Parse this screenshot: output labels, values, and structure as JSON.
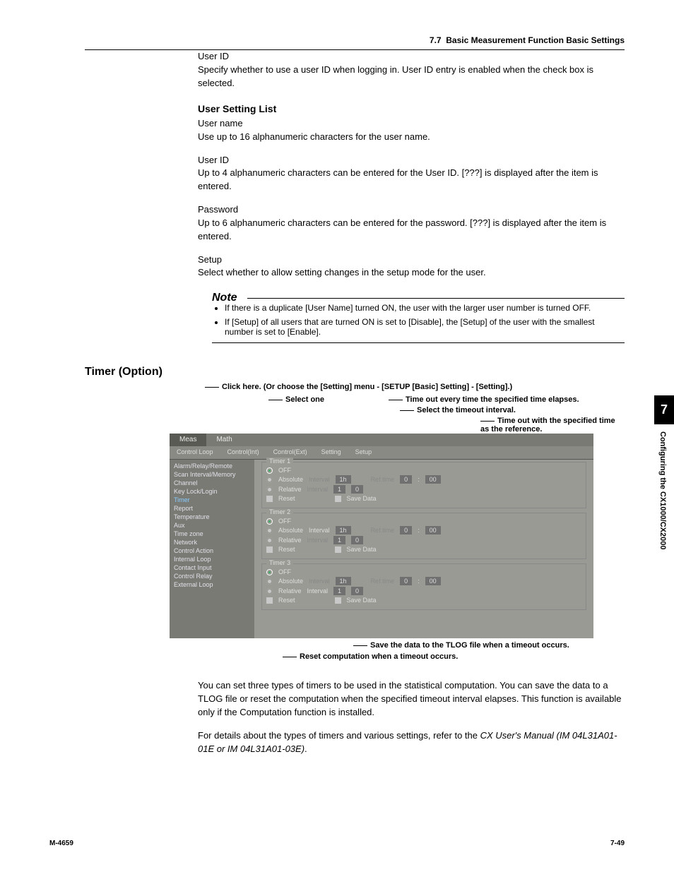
{
  "header": {
    "section_number": "7.7",
    "section_title": "Basic Measurement Function Basic Settings"
  },
  "userid_block": {
    "label": "User ID",
    "text": "Specify whether to use a user ID when logging in. User ID entry is enabled when the check box is selected."
  },
  "user_setting_list": {
    "heading": "User Setting List",
    "username": {
      "label": "User name",
      "text": "Use up to 16 alphanumeric characters for the user name."
    },
    "userid": {
      "label": "User ID",
      "text": "Up to 4 alphanumeric characters can be entered for the User ID.  [???] is displayed after the item is entered."
    },
    "password": {
      "label": "Password",
      "text": "Up to 6 alphanumeric characters can be entered for the password.  [???] is displayed after the item is entered."
    },
    "setup": {
      "label": "Setup",
      "text": "Select whether to allow setting changes in the setup mode for the user."
    }
  },
  "note": {
    "title": "Note",
    "items": [
      "If there is a duplicate [User Name] turned ON, the user with the larger user number is turned OFF.",
      "If [Setup] of all users that are turned ON is set to [Disable], the [Setup] of the user with the smallest number is set to [Enable]."
    ]
  },
  "timer_section_heading": "Timer (Option)",
  "callouts_top": {
    "click": "Click here. (Or choose the [Setting] menu - [SETUP [Basic] Setting] - [Setting].)",
    "select_one": "Select one",
    "timeout_every": "Time out every time the specified time elapses.",
    "timeout_interval": "Select the timeout interval.",
    "timeout_ref": "Time out with the specified time as the reference."
  },
  "screenshot": {
    "top_tabs": [
      "Meas",
      "Math"
    ],
    "sub_tabs": [
      "Control Loop",
      "Control(Int)",
      "Control(Ext)",
      "Setting",
      "Setup"
    ],
    "sidebar": [
      "Alarm/Relay/Remote",
      "Scan Interval/Memory",
      "Channel",
      "Key Lock/Login",
      "Timer",
      "Report",
      "Temperature",
      "Aux",
      "Time zone",
      "Network",
      "Control Action",
      "Internal Loop",
      "Contact Input",
      "Control Relay",
      "External Loop"
    ],
    "sidebar_active": "Timer",
    "groups": [
      {
        "label": "Timer 1",
        "off": "OFF",
        "absolute": "Absolute",
        "abs_int_lbl": "Interval",
        "abs_int_val": "1h",
        "ref_lbl": "Ref.time",
        "ref_h": "0",
        "ref_m": "00",
        "relative": "Relative",
        "rel_int_lbl": "Interval",
        "rel_h": "1",
        "rel_m": "0",
        "reset": "Reset",
        "save": "Save Data"
      },
      {
        "label": "Timer 2",
        "off": "OFF",
        "absolute": "Absolute",
        "abs_int_lbl": "Interval",
        "abs_int_val": "1h",
        "ref_lbl": "Ref.time",
        "ref_h": "0",
        "ref_m": "00",
        "relative": "Relative",
        "rel_int_lbl": "Interval",
        "rel_h": "1",
        "rel_m": "0",
        "reset": "Reset",
        "save": "Save Data"
      },
      {
        "label": "Timer 3",
        "off": "OFF",
        "absolute": "Absolute",
        "abs_int_lbl": "Interval",
        "abs_int_val": "1h",
        "ref_lbl": "Ref.time",
        "ref_h": "0",
        "ref_m": "00",
        "relative": "Relative",
        "rel_int_lbl": "Interval",
        "rel_h": "1",
        "rel_m": "0",
        "reset": "Reset",
        "save": "Save Data"
      }
    ]
  },
  "callouts_bottom": {
    "save": "Save the data to the TLOG file when a timeout occurs.",
    "reset": "Reset computation when a timeout occurs."
  },
  "timer_explain": {
    "p1": "You can set three types of timers to be used in the statistical computation.  You can save the data to a TLOG file or reset the computation when the specified timeout interval elapses.  This function is available only if the Computation function is installed.",
    "p2a": "For details about the types of timers and various settings, refer to the ",
    "p2b": "CX User's Manual (IM 04L31A01-01E or IM 04L31A01-03E)",
    "p2c": "."
  },
  "side_tab": {
    "num": "7",
    "text": "Configuring the CX1000/CX2000"
  },
  "footer": {
    "left": "M-4659",
    "right": "7-49"
  }
}
